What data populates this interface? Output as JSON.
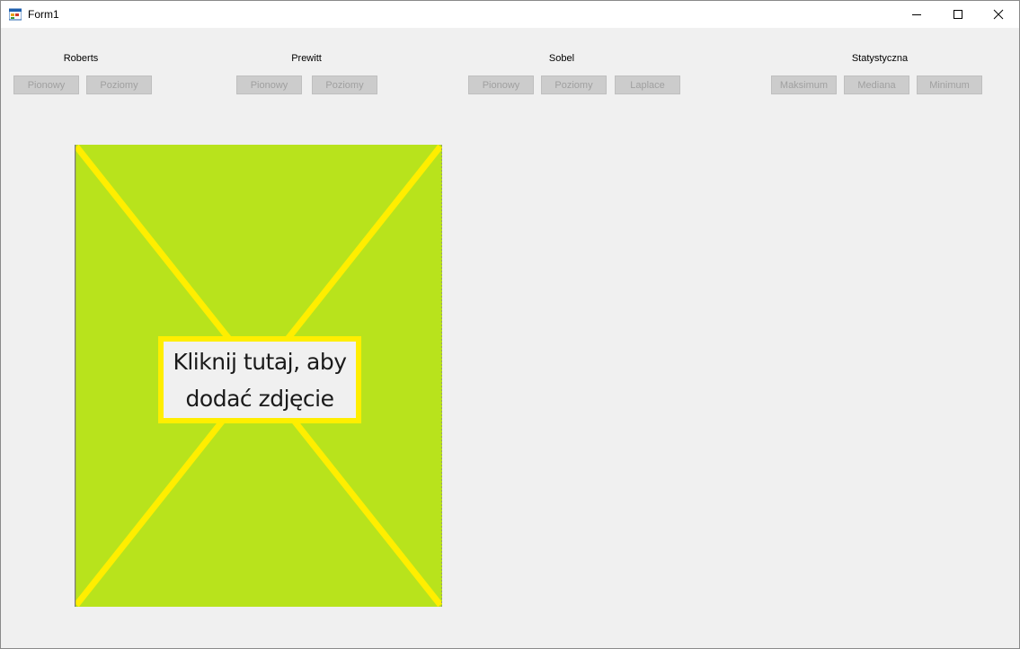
{
  "window": {
    "title": "Form1",
    "icon": "winforms-app-icon",
    "controls": {
      "minimize": "minimize-icon",
      "maximize": "maximize-icon",
      "close": "close-icon"
    }
  },
  "groups": [
    {
      "label": "Roberts",
      "buttons": [
        "Pionowy",
        "Poziomy"
      ]
    },
    {
      "label": "Prewitt",
      "buttons": [
        "Pionowy",
        "Poziomy"
      ]
    },
    {
      "label": "Sobel",
      "buttons": [
        "Pionowy",
        "Poziomy",
        "Laplace"
      ]
    },
    {
      "label": "Statystyczna",
      "buttons": [
        "Maksimum",
        "Mediana",
        "Minimum"
      ]
    }
  ],
  "picture": {
    "placeholder_line1": "Kliknij tutaj, aby",
    "placeholder_line2": "dodać zdjęcie",
    "fill_color": "#b8e31c",
    "stroke_color": "#ffee00"
  },
  "colors": {
    "background": "#f0f0f0",
    "titlebar": "#ffffff",
    "button_disabled_bg": "#cccccc",
    "button_disabled_text": "#a0a0a0"
  }
}
